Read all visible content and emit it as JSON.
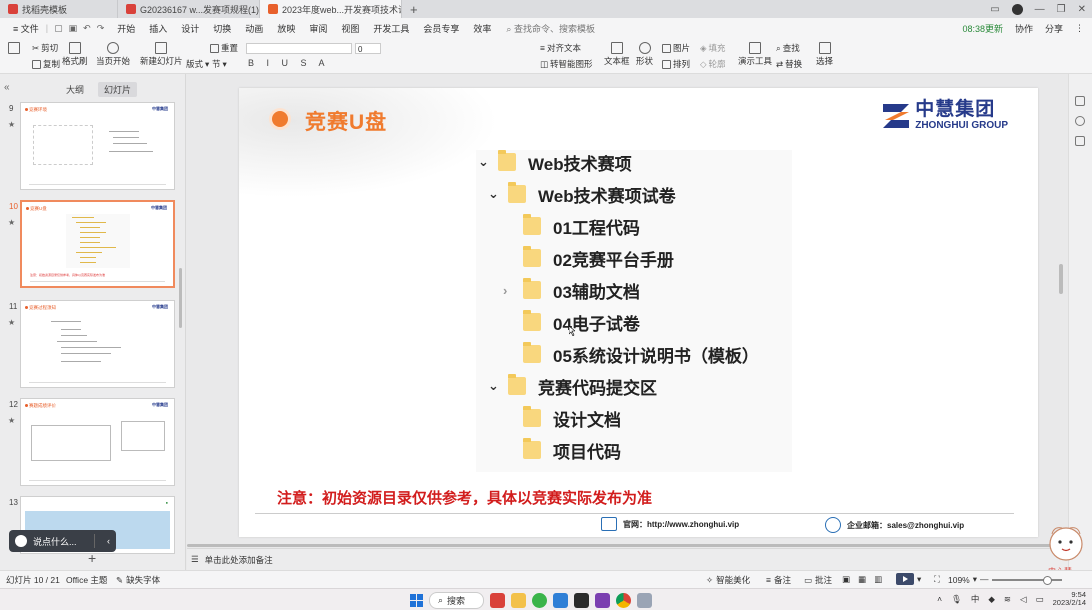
{
  "tabs": [
    {
      "label": "找稻壳模板",
      "color": "#d9413a"
    },
    {
      "label": "G20236167  w...发赛项规程(1).pdf",
      "color": "#d9413a"
    },
    {
      "label": "2023年度web...开发赛项技术说明会",
      "color": "#e8602c"
    }
  ],
  "window": {
    "new_tab": "+"
  },
  "menubar": {
    "file": "≡ 文件",
    "autosave": "自动保存",
    "start": "开始",
    "items": [
      "插入",
      "设计",
      "切换",
      "动画",
      "放映",
      "审阅",
      "视图",
      "开发工具",
      "会员专享",
      "效率"
    ],
    "search_placeholder": "查找命令、搜索模板",
    "sync": "08:38更新",
    "collab": "协作",
    "share": "分享"
  },
  "ribbon": {
    "cut": "剪切",
    "copy": "复制",
    "format_painter": "格式刷",
    "from_start": "当页开始",
    "new_slide": "新建幻灯片",
    "layout": "版式",
    "section": "节",
    "reset": "重置",
    "font_sample": "0",
    "format_glyphs": "B I U S A",
    "align_text": "对齐文本",
    "convert_smartart": "转智能图形",
    "textbox": "文本框",
    "shape": "形状",
    "picture": "图片",
    "fill": "填充",
    "arrange": "排列",
    "outline": "轮廓",
    "presentation_tools": "演示工具",
    "find": "查找",
    "replace": "替换",
    "select": "选择"
  },
  "leftpanel": {
    "tab_outline": "大纲",
    "tab_slides": "幻灯片",
    "collapse": "«",
    "slides": [
      {
        "num": "9",
        "title": "竞赛环境"
      },
      {
        "num": "10",
        "title": "竞赛U盘"
      },
      {
        "num": "11",
        "title": "竞赛过程须知"
      },
      {
        "num": "12",
        "title": "赛题成绩评价"
      },
      {
        "num": "13",
        "title": ""
      }
    ],
    "chat_placeholder": "说点什么...",
    "add": "+"
  },
  "slide": {
    "title": "竞赛U盘",
    "logo_cn": "中慧集团",
    "logo_en": "ZHONGHUI GROUP",
    "tree": [
      {
        "label": "Web技术赛项",
        "level": 0,
        "expander": "open"
      },
      {
        "label": "Web技术赛项试卷",
        "level": 1,
        "expander": "open"
      },
      {
        "label": "01工程代码",
        "level": 2,
        "expander": "none"
      },
      {
        "label": "02竞赛平台手册",
        "level": 2,
        "expander": "none"
      },
      {
        "label": "03辅助文档",
        "level": 2,
        "expander": "closed"
      },
      {
        "label": "04电子试卷",
        "level": 2,
        "expander": "none"
      },
      {
        "label": "05系统设计说明书（模板）",
        "level": 2,
        "expander": "none"
      },
      {
        "label": "竞赛代码提交区",
        "level": 1,
        "expander": "open"
      },
      {
        "label": "设计文档",
        "level": 2,
        "expander": "none"
      },
      {
        "label": "项目代码",
        "level": 2,
        "expander": "none"
      }
    ],
    "notice": "注意：初始资源目录仅供参考，具体以竞赛实际发布为准",
    "footer_site": "官网：http://www.zhonghui.vip",
    "footer_mail": "企业邮箱：sales@zhonghui.vip"
  },
  "notes": {
    "placeholder": "单击此处添加备注"
  },
  "status": {
    "slide_counter": "幻灯片 10 / 21",
    "theme": "Office 主题",
    "missing_font": "缺失字体",
    "smart_beautify": "智能美化",
    "notes_btn": "备注",
    "comments_btn": "批注",
    "zoom": "109%"
  },
  "taskbar": {
    "search": "搜索",
    "ime": "中",
    "time": "9:54",
    "date": "2023/2/14"
  },
  "mascot_text": "中心慧"
}
